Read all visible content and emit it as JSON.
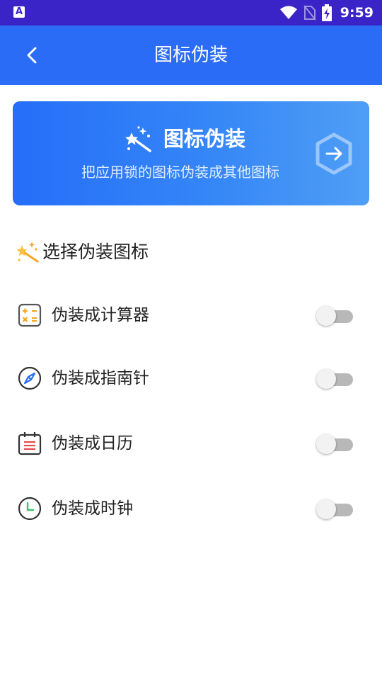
{
  "status_bar": {
    "app_indicator": "A",
    "time": "9:59"
  },
  "app_bar": {
    "title": "图标伪装"
  },
  "banner": {
    "title": "图标伪装",
    "subtitle": "把应用锁的图标伪装成其他图标"
  },
  "section": {
    "title": "选择伪装图标"
  },
  "options": [
    {
      "label": "伪装成计算器",
      "icon": "calculator-icon",
      "enabled": false
    },
    {
      "label": "伪装成指南针",
      "icon": "compass-icon",
      "enabled": false
    },
    {
      "label": "伪装成日历",
      "icon": "calendar-icon",
      "enabled": false
    },
    {
      "label": "伪装成时钟",
      "icon": "clock-icon",
      "enabled": false
    }
  ],
  "colors": {
    "status_bar": "#3a24c8",
    "app_bar": "#2a6cf6",
    "banner_start": "#256ef9",
    "banner_end": "#4f9ef6",
    "accent_orange": "#f5a623",
    "compass_blue": "#2a6cf6",
    "calendar_red": "#e84b4b",
    "clock_green": "#3cc36b"
  }
}
